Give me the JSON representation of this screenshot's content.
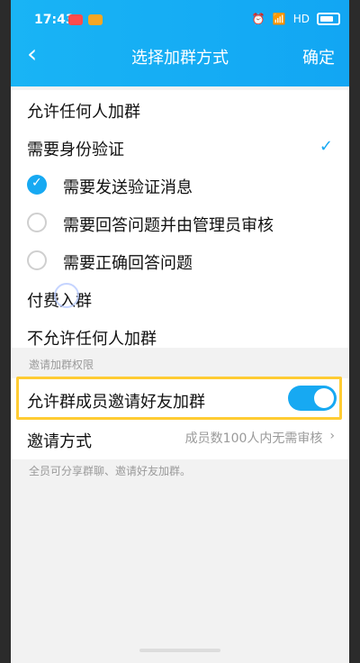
{
  "status_bar": {
    "time": "17:43",
    "right_text": "HD"
  },
  "header": {
    "title": "选择加群方式",
    "back_icon": "chevron-left-icon",
    "confirm_label": "确定"
  },
  "options": [
    {
      "label": "允许任何人加群"
    },
    {
      "label": "需要身份验证",
      "checked": true
    },
    {
      "label": "需要发送验证消息",
      "radio_selected": true
    },
    {
      "label": "需要回答问题并由管理员审核",
      "radio_selected": false
    },
    {
      "label": "需要正确回答问题",
      "radio_selected": false
    },
    {
      "label": "付费入群"
    },
    {
      "label": "不允许任何人加群"
    }
  ],
  "invite_section": {
    "title": "邀请加群权限",
    "allow_invite_label": "允许群成员邀请好友加群",
    "allow_invite_enabled": true,
    "method_label": "邀请方式",
    "method_value": "成员数100人内无需审核",
    "note": "全员可分享群聊、邀请好友加群。"
  },
  "colors": {
    "accent": "#17A9F2",
    "highlight": "#FFCC33"
  }
}
